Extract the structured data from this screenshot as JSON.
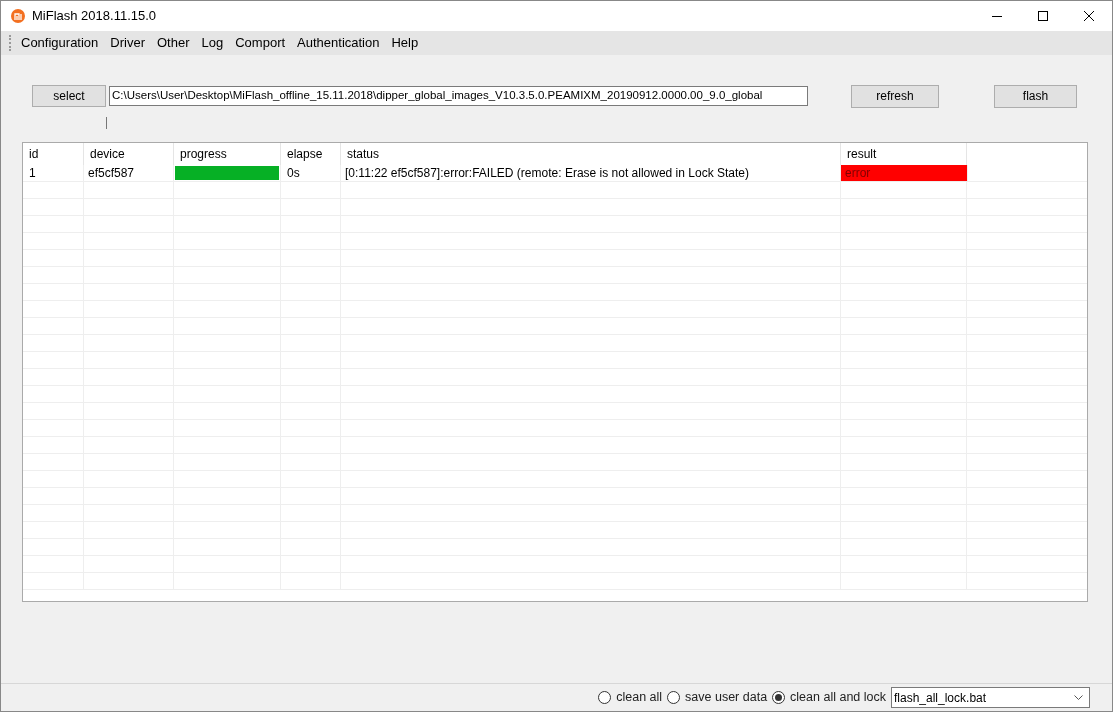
{
  "window": {
    "title": "MiFlash 2018.11.15.0"
  },
  "menu": [
    "Configuration",
    "Driver",
    "Other",
    "Log",
    "Comport",
    "Authentication",
    "Help"
  ],
  "toolbar": {
    "select_button": "select",
    "path_field": "C:\\Users\\User\\Desktop\\MiFlash_offline_15.11.2018\\dipper_global_images_V10.3.5.0.PEAMIXM_20190912.0000.00_9.0_global",
    "refresh_button": "refresh",
    "flash_button": "flash"
  },
  "table": {
    "columns": [
      "id",
      "device",
      "progress",
      "elapse",
      "status",
      "result"
    ],
    "rows": [
      {
        "id": "1",
        "device": "ef5cf587",
        "progress": {
          "level": 1
        },
        "elapse": "0s",
        "status": "[0:11:22  ef5cf587]:error:FAILED (remote: Erase is not allowed in Lock State)",
        "result": {
          "text": "error",
          "color": "#ff0000"
        }
      }
    ]
  },
  "status_bar": {
    "options": [
      {
        "label": "clean all",
        "selected": false
      },
      {
        "label": "save user data",
        "selected": false
      },
      {
        "label": "clean all and lock",
        "selected": true
      }
    ],
    "script": "flash_all_lock.bat"
  }
}
